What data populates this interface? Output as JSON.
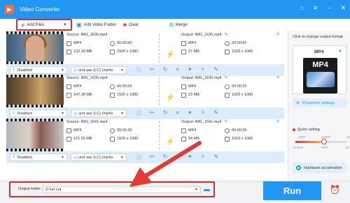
{
  "app": {
    "title": "Video Converter"
  },
  "toolbar": {
    "add_files": "Add Files",
    "add_video_folder": "Add Video Folder",
    "clear": "Clear",
    "merge": "Merge"
  },
  "tasks": [
    {
      "source": "Source: IMG_1635.mp4",
      "output": "Output: IMG_1635.mp4",
      "src_format": "MP4",
      "src_duration": "00:00:42",
      "src_size": "132.28 MB",
      "src_res": "1920 x 1080",
      "out_format": "MP4",
      "out_duration": "00:00:42",
      "out_size": "37 MB",
      "out_res": "1920 x 1080",
      "subtitle": "Disabled",
      "audio": "und aac (LC) (mp4a"
    },
    {
      "source": "Source: IMG_1636.mp4",
      "output": "Output: IMG_1636.mp4",
      "src_format": "MP4",
      "src_duration": "00:00:26",
      "src_size": "147.38 MB",
      "src_res": "1920 x 1080",
      "out_format": "MP4",
      "out_duration": "00:00:26",
      "out_size": "23 MB",
      "out_res": "1920 x 1080",
      "subtitle": "Disabled",
      "audio": "und aac (LC) (mp4a"
    },
    {
      "source": "Source: IMG_1641.mp4",
      "output": "Output: IMG_1641.mp4",
      "src_format": "MP4",
      "src_duration": "00:00:39",
      "src_size": "121.56 MB",
      "src_res": "1920 x 1080",
      "out_format": "MP4",
      "out_duration": "00:00:39",
      "out_size": "34 MB",
      "out_res": "1920 x 1080",
      "subtitle": "Disabled",
      "audio": "und aac (LC) (mp4a"
    }
  ],
  "panel": {
    "title": "Click to change output format",
    "format": "MP4",
    "format_icon_text": "MP4",
    "parameter_settings": "Parameter settings",
    "quick_setting": "Quick setting",
    "slider_top": [
      "480P",
      "1080P",
      "4K"
    ],
    "slider_bottom": [
      "Default",
      "720P",
      "2K"
    ],
    "quality_level": 0.55,
    "hardware_acceleration": "Hardware acceleration"
  },
  "bottom": {
    "output_folder_label": "Output folder:",
    "output_folder_path": "D:\\hd out",
    "run": "Run"
  },
  "colors": {
    "accent": "#2196f3",
    "highlight": "#d32f2f",
    "bolt": "#ff8a00"
  }
}
